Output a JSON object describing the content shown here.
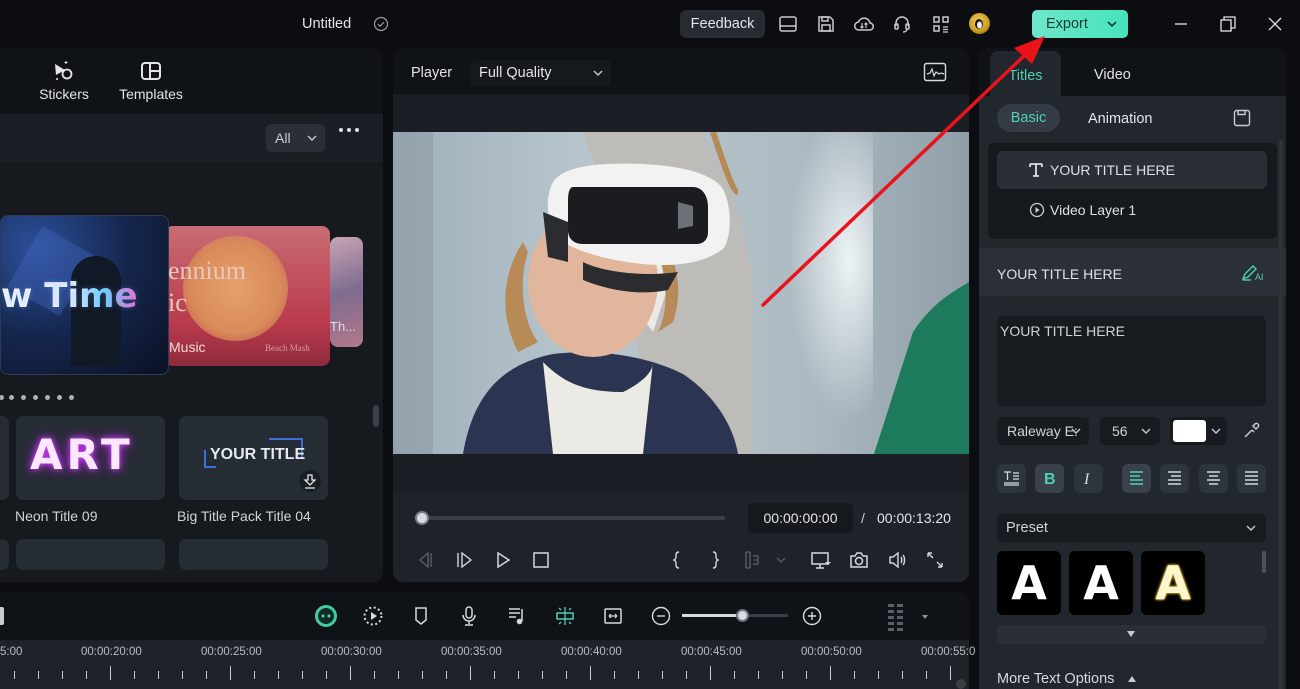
{
  "window": {
    "title": "Untitled",
    "feedback_label": "Feedback",
    "export_label": "Export",
    "icons": [
      "saved-check-icon",
      "layout-icon",
      "save-icon",
      "cloud-sync-icon",
      "support-headset-icon",
      "apps-grid-icon",
      "avatar",
      "minimize-icon",
      "restore-icon",
      "close-icon"
    ]
  },
  "left_panel": {
    "tabs": [
      {
        "label": "Stickers",
        "icon": "stickers-icon"
      },
      {
        "label": "Templates",
        "icon": "templates-icon"
      }
    ],
    "filter": {
      "selected": "All"
    },
    "carousel": [
      {
        "text": "w Time"
      },
      {
        "text": "ennium",
        "text2": "ic",
        "label": "Music",
        "sub": "Beach Mash"
      },
      {
        "text": "Th..."
      }
    ],
    "title_cards": [
      {
        "name": "Neon Title 09",
        "preview": "ART"
      },
      {
        "name": "Big Title Pack Title 04",
        "preview": "YOUR TITLE",
        "downloadable": true
      }
    ]
  },
  "player": {
    "label": "Player",
    "quality": "Full Quality",
    "current_time": "00:00:00:00",
    "separator": "/",
    "total_time": "00:00:13:20",
    "progress": 0
  },
  "right_panel": {
    "tabs": [
      "Titles",
      "Video"
    ],
    "active_tab": "Titles",
    "subtabs": [
      "Basic",
      "Animation"
    ],
    "active_subtab": "Basic",
    "layers": [
      {
        "label": "YOUR TITLE HERE",
        "icon": "text-icon",
        "selected": true
      },
      {
        "label": "Video Layer 1",
        "icon": "play-circle-icon",
        "selected": false
      }
    ],
    "section_title": "YOUR TITLE HERE",
    "text_value": "YOUR TITLE HERE",
    "font": "Raleway E:",
    "font_size": "56",
    "color": "#ffffff",
    "format_buttons": [
      "text-spacing",
      "bold",
      "italic",
      "align-left",
      "align-right",
      "align-center",
      "justify"
    ],
    "active_format": [
      "bold",
      "align-left"
    ],
    "preset_label": "Preset",
    "presets": [
      "A",
      "A",
      "A"
    ],
    "more_options": "More Text Options"
  },
  "timeline": {
    "zoom_level": 0.58,
    "ruler_labels": [
      "5:00",
      "00:00:20:00",
      "00:00:25:00",
      "00:00:30:00",
      "00:00:35:00",
      "00:00:40:00",
      "00:00:45:00",
      "00:00:50:00",
      "00:00:55:0"
    ]
  },
  "colors": {
    "accent": "#4fd1b1",
    "export_bg": "#5ae5c4",
    "annotation_arrow": "#e8131b"
  }
}
